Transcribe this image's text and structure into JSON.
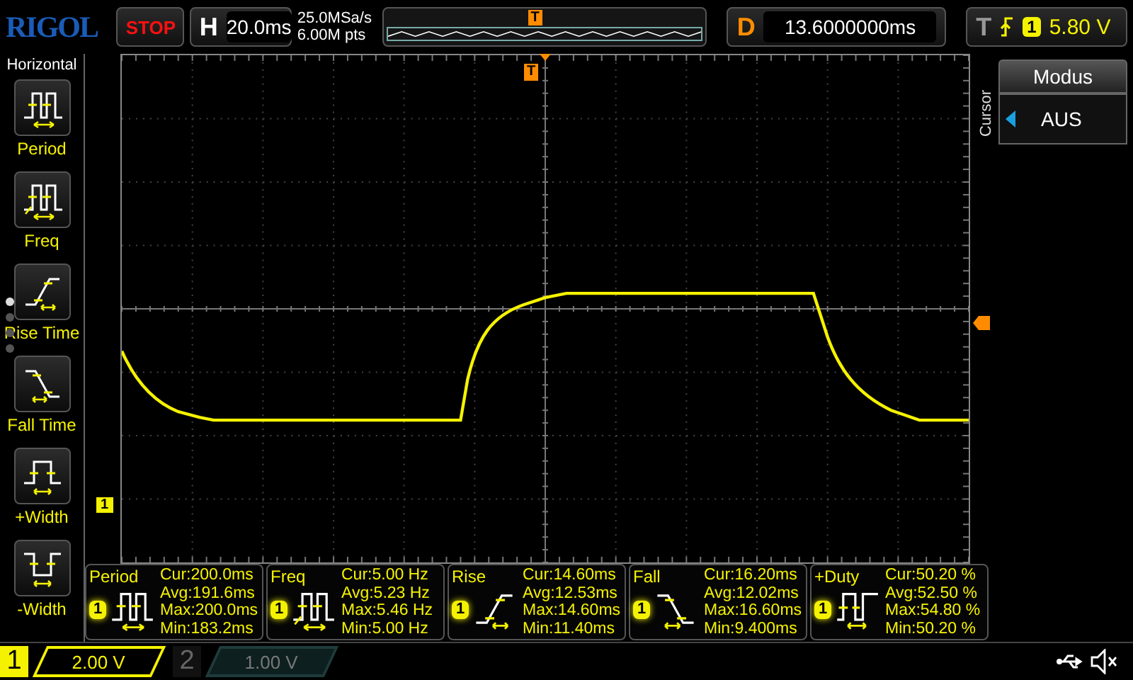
{
  "logo": "RIGOL",
  "run_state": "STOP",
  "horizontal": {
    "label": "H",
    "timebase": "20.0ms"
  },
  "acquisition": {
    "sample_rate": "25.0MSa/s",
    "memory_depth": "6.00M pts",
    "trigger_mark": "T"
  },
  "delay": {
    "label": "D",
    "value": "13.6000000ms"
  },
  "trigger": {
    "label": "T",
    "channel": "1",
    "level": "5.80 V"
  },
  "menu": {
    "title": "Horizontal",
    "pages": [
      {
        "selected": true
      },
      {
        "selected": false
      },
      {
        "selected": false
      },
      {
        "selected": false
      }
    ],
    "items": [
      {
        "label": "Period",
        "kind": "period"
      },
      {
        "label": "Freq",
        "kind": "freq"
      },
      {
        "label": "Rise Time",
        "kind": "rise"
      },
      {
        "label": "Fall Time",
        "kind": "fall"
      },
      {
        "label": "+Width",
        "kind": "pwidth"
      },
      {
        "label": "-Width",
        "kind": "nwidth"
      }
    ]
  },
  "screen": {
    "trigger_position": "T",
    "channel_marker": "1"
  },
  "side_menu": {
    "title": "Modus",
    "caption": "Cursor",
    "value": "AUS"
  },
  "measurements": [
    {
      "title": "Period",
      "channel": "1",
      "kind": "period",
      "lines": [
        "Cur:200.0ms",
        "Avg:191.6ms",
        "Max:200.0ms",
        "Min:183.2ms"
      ]
    },
    {
      "title": "Freq",
      "channel": "1",
      "kind": "freq",
      "lines": [
        "Cur:5.00 Hz",
        "Avg:5.23 Hz",
        "Max:5.46 Hz",
        "Min:5.00 Hz"
      ]
    },
    {
      "title": "Rise",
      "channel": "1",
      "kind": "rise",
      "lines": [
        "Cur:14.60ms",
        "Avg:12.53ms",
        "Max:14.60ms",
        "Min:11.40ms"
      ]
    },
    {
      "title": "Fall",
      "channel": "1",
      "kind": "fall",
      "lines": [
        "Cur:16.20ms",
        "Avg:12.02ms",
        "Max:16.60ms",
        "Min:9.400ms"
      ]
    },
    {
      "title": "+Duty",
      "channel": "1",
      "kind": "duty",
      "lines": [
        "Cur:50.20 %",
        "Avg:52.50 %",
        "Max:54.80 %",
        "Min:50.20 %"
      ]
    }
  ],
  "channels": [
    {
      "number": "1",
      "scale": "2.00 V",
      "on": true
    },
    {
      "number": "2",
      "scale": "1.00 V",
      "on": false
    }
  ]
}
